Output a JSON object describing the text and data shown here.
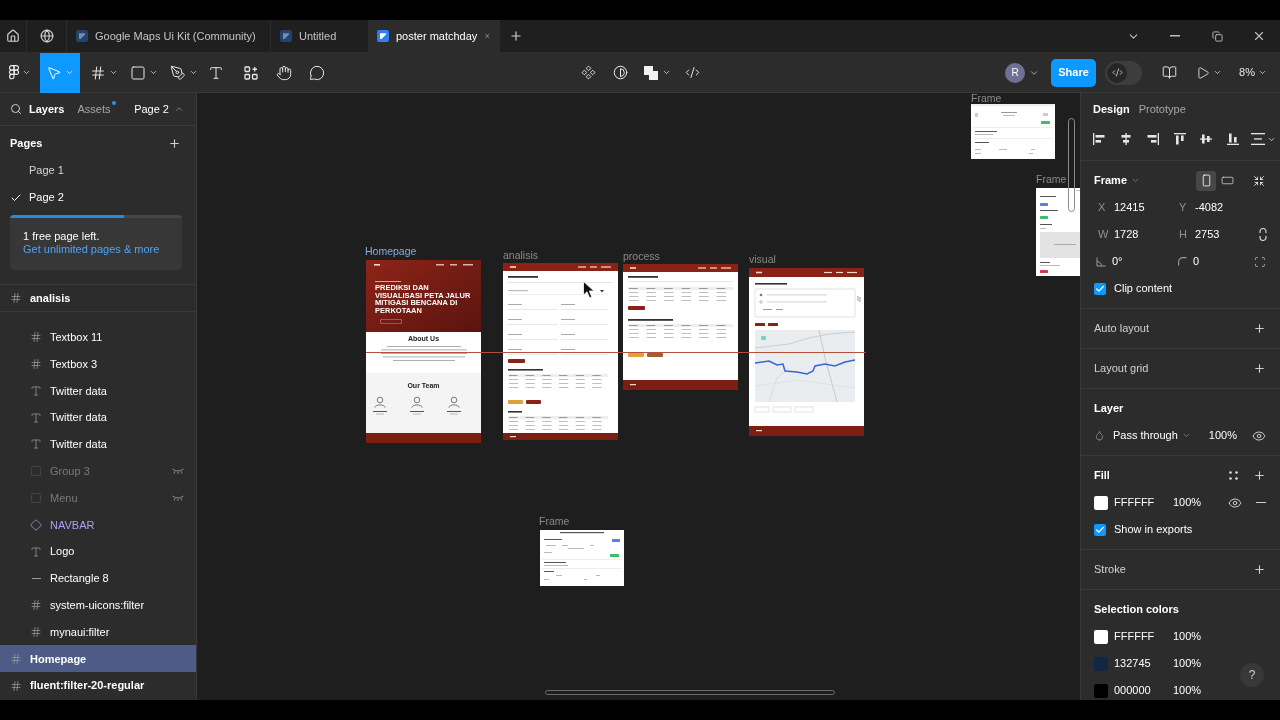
{
  "title_bar": {
    "tabs": [
      {
        "label": "Google Maps Ui Kit (Community)",
        "selected": false
      },
      {
        "label": "Untitled",
        "selected": false
      },
      {
        "label": "poster matchday",
        "selected": true
      }
    ]
  },
  "toolbar": {
    "tools": [
      {
        "kind": "move",
        "selected": true,
        "has_menu": true
      },
      {
        "kind": "frame",
        "selected": false,
        "has_menu": true
      },
      {
        "kind": "shape",
        "selected": false,
        "has_menu": true
      },
      {
        "kind": "pen",
        "selected": false,
        "has_menu": true
      },
      {
        "kind": "text",
        "selected": false,
        "has_menu": false
      },
      {
        "kind": "resources",
        "selected": false,
        "has_menu": false
      },
      {
        "kind": "hand",
        "selected": false,
        "has_menu": false
      },
      {
        "kind": "comment",
        "selected": false,
        "has_menu": false
      }
    ],
    "user_initial": "R",
    "share_label": "Share",
    "dev_mode": false,
    "zoom": "8%"
  },
  "left_panel": {
    "tabs": [
      {
        "label": "Layers",
        "selected": true,
        "badge": false
      },
      {
        "label": "Assets",
        "selected": false,
        "badge": true
      }
    ],
    "page_menu": "Page 2",
    "pages_title": "Pages",
    "pages": [
      {
        "label": "Page 1",
        "selected": false
      },
      {
        "label": "Page 2",
        "selected": true
      }
    ],
    "upgrade": {
      "level": 0.66,
      "message": "1 free page left.",
      "link": "Get unlimited pages & more"
    },
    "layers": [
      {
        "name": "analisis",
        "kind": "frame",
        "selected": false,
        "hidden": false,
        "children": [
          {
            "name": "Textbox 11",
            "kind": "frame",
            "selected": false,
            "hidden": false
          },
          {
            "name": "Textbox 3",
            "kind": "frame",
            "selected": false,
            "hidden": false
          },
          {
            "name": "Twitter data",
            "kind": "text",
            "selected": false,
            "hidden": false
          },
          {
            "name": "Twitter data",
            "kind": "text",
            "selected": false,
            "hidden": false
          },
          {
            "name": "Twitter data",
            "kind": "text",
            "selected": false,
            "hidden": false
          },
          {
            "name": "Group 3",
            "kind": "group",
            "selected": false,
            "hidden": true
          },
          {
            "name": "Menu",
            "kind": "group",
            "selected": false,
            "hidden": true
          },
          {
            "name": "NAVBAR",
            "kind": "component",
            "selected": false,
            "hidden": false
          },
          {
            "name": "Logo",
            "kind": "text",
            "selected": false,
            "hidden": false
          },
          {
            "name": "Rectangle 8",
            "kind": "line",
            "selected": false,
            "hidden": false
          },
          {
            "name": "system-uicons:filter",
            "kind": "frame",
            "selected": false,
            "hidden": false
          },
          {
            "name": "mynaui:filter",
            "kind": "frame",
            "selected": false,
            "hidden": false
          }
        ]
      },
      {
        "name": "Homepage",
        "kind": "frame",
        "selected": true,
        "hidden": false
      },
      {
        "name": "fluent:filter-20-regular",
        "kind": "frame",
        "selected": false,
        "hidden": false
      }
    ]
  },
  "canvas": {
    "frames": [
      {
        "label": "Frame",
        "kind": "widget-table",
        "selected": false
      },
      {
        "label": "Frame",
        "kind": "widget-panel",
        "selected": false
      },
      {
        "label": "Homepage",
        "kind": "homepage",
        "selected": true,
        "hero_title": "PREDIKSI DAN VISUALISASI PETA JALUR MITIGASI BENCANA DI PERKOTAAN",
        "about_title": "About Us",
        "team_title": "Our Team"
      },
      {
        "label": "analisis",
        "kind": "analysis",
        "selected": false
      },
      {
        "label": "process",
        "kind": "process",
        "selected": false
      },
      {
        "label": "visual",
        "kind": "map-page",
        "selected": false
      },
      {
        "label": "Frame",
        "kind": "widget-form",
        "selected": false
      }
    ]
  },
  "right_panel": {
    "tabs": [
      {
        "label": "Design",
        "selected": true
      },
      {
        "label": "Prototype",
        "selected": false
      }
    ],
    "frame": {
      "title": "Frame",
      "orientation_options": [
        {
          "kind": "portrait",
          "selected": true
        },
        {
          "kind": "landscape",
          "selected": false
        }
      ],
      "fields": [
        {
          "label": "X",
          "value": "12415"
        },
        {
          "label": "Y",
          "value": "-4082"
        },
        {
          "label": "W",
          "value": "1728"
        },
        {
          "label": "H",
          "value": "2753"
        }
      ],
      "rotation": "0°",
      "corner_radius": "0",
      "clip_content": {
        "label": "Clip content",
        "checked": true
      }
    },
    "auto_layout": {
      "title": "Auto layout"
    },
    "layout_grid": {
      "title": "Layout grid"
    },
    "layer": {
      "title": "Layer",
      "blend_mode": "Pass through",
      "opacity": "100%"
    },
    "fill": {
      "title": "Fill",
      "paints": [
        {
          "hex": "FFFFFF",
          "opacity": "100%",
          "color": "#ffffff"
        }
      ],
      "show_in_exports": {
        "label": "Show in exports",
        "checked": true
      }
    },
    "stroke": {
      "title": "Stroke"
    },
    "selection_colors": {
      "title": "Selection colors",
      "colors": [
        {
          "hex": "FFFFFF",
          "opacity": "100%",
          "color": "#ffffff"
        },
        {
          "hex": "132745",
          "opacity": "100%",
          "color": "#132745"
        },
        {
          "hex": "000000",
          "opacity": "100%",
          "color": "#000000"
        }
      ]
    }
  },
  "help_label": "?"
}
